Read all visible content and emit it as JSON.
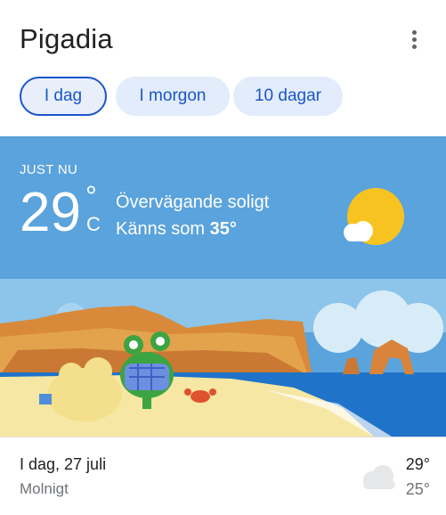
{
  "header": {
    "title": "Pigadia",
    "menu_icon": "more-vert-icon"
  },
  "tabs": [
    {
      "label": "I dag",
      "active": true
    },
    {
      "label": "I morgon",
      "active": false
    },
    {
      "label": "10 dagar",
      "active": false
    }
  ],
  "current": {
    "label": "JUST NU",
    "temperature": "29",
    "degree_symbol": "°",
    "unit": "C",
    "condition": "Övervägande soligt",
    "feels_like_prefix": "Känns som",
    "feels_like_value": "35°",
    "icon": "sun-with-cloud-icon"
  },
  "forecast": {
    "day": "I dag, 27 juli",
    "description": "Molnigt",
    "high": "29°",
    "low": "25°",
    "icon": "cloud-icon"
  },
  "colors": {
    "accent": "#1a56c8",
    "tab_bg": "#e3ecfb",
    "sky": "#5aa3dc",
    "sun": "#f7c320",
    "sea": "#1f74c9",
    "sand": "#f6e7a4"
  }
}
